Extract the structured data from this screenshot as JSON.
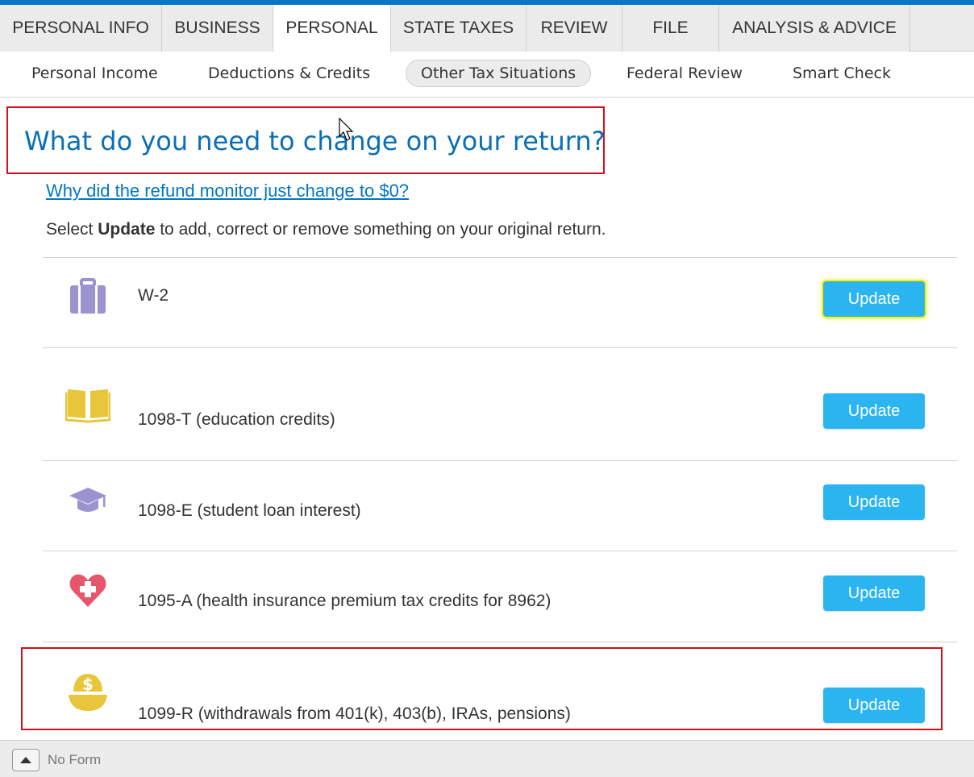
{
  "main_tabs": [
    {
      "label": "PERSONAL INFO",
      "active": false
    },
    {
      "label": "BUSINESS",
      "active": false
    },
    {
      "label": "PERSONAL",
      "active": true
    },
    {
      "label": "STATE TAXES",
      "active": false
    },
    {
      "label": "REVIEW",
      "active": false
    },
    {
      "label": "FILE",
      "active": false
    },
    {
      "label": "ANALYSIS & ADVICE",
      "active": false
    }
  ],
  "sub_tabs": [
    {
      "label": "Personal Income",
      "active": false
    },
    {
      "label": "Deductions & Credits",
      "active": false
    },
    {
      "label": "Other Tax Situations",
      "active": true
    },
    {
      "label": "Federal Review",
      "active": false
    },
    {
      "label": "Smart Check",
      "active": false
    }
  ],
  "page": {
    "title": "What do you need to change on your return?",
    "refund_link": "Why did the refund monitor just change to $0?",
    "instruction_prefix": "Select ",
    "instruction_bold": "Update",
    "instruction_suffix": " to add, correct or remove something on your original return."
  },
  "forms": [
    {
      "label": "W-2",
      "icon": "briefcase-icon",
      "icon_color": "#9b93cf",
      "button": "Update"
    },
    {
      "label": "1098-T (education credits)",
      "icon": "open-book-icon",
      "icon_color": "#e8c53a",
      "button": "Update"
    },
    {
      "label": "1098-E (student loan interest)",
      "icon": "graduation-cap-icon",
      "icon_color": "#9b93cf",
      "button": "Update"
    },
    {
      "label": "1095-A (health insurance premium tax credits for 8962)",
      "icon": "heart-plus-icon",
      "icon_color": "#e8566c",
      "button": "Update"
    },
    {
      "label": "1099-R (withdrawals from 401(k), 403(b), IRAs, pensions)",
      "icon": "money-bag-icon",
      "icon_color": "#e8c53a",
      "button": "Update"
    }
  ],
  "footer": {
    "label": "No Form",
    "icon": "triangle-up-icon"
  },
  "colors": {
    "brand_blue": "#0077c5",
    "title_blue": "#0b6fb5",
    "button_blue": "#2bb5f0",
    "highlight_red": "#d0121b",
    "focus_yellow": "#f7f200"
  }
}
